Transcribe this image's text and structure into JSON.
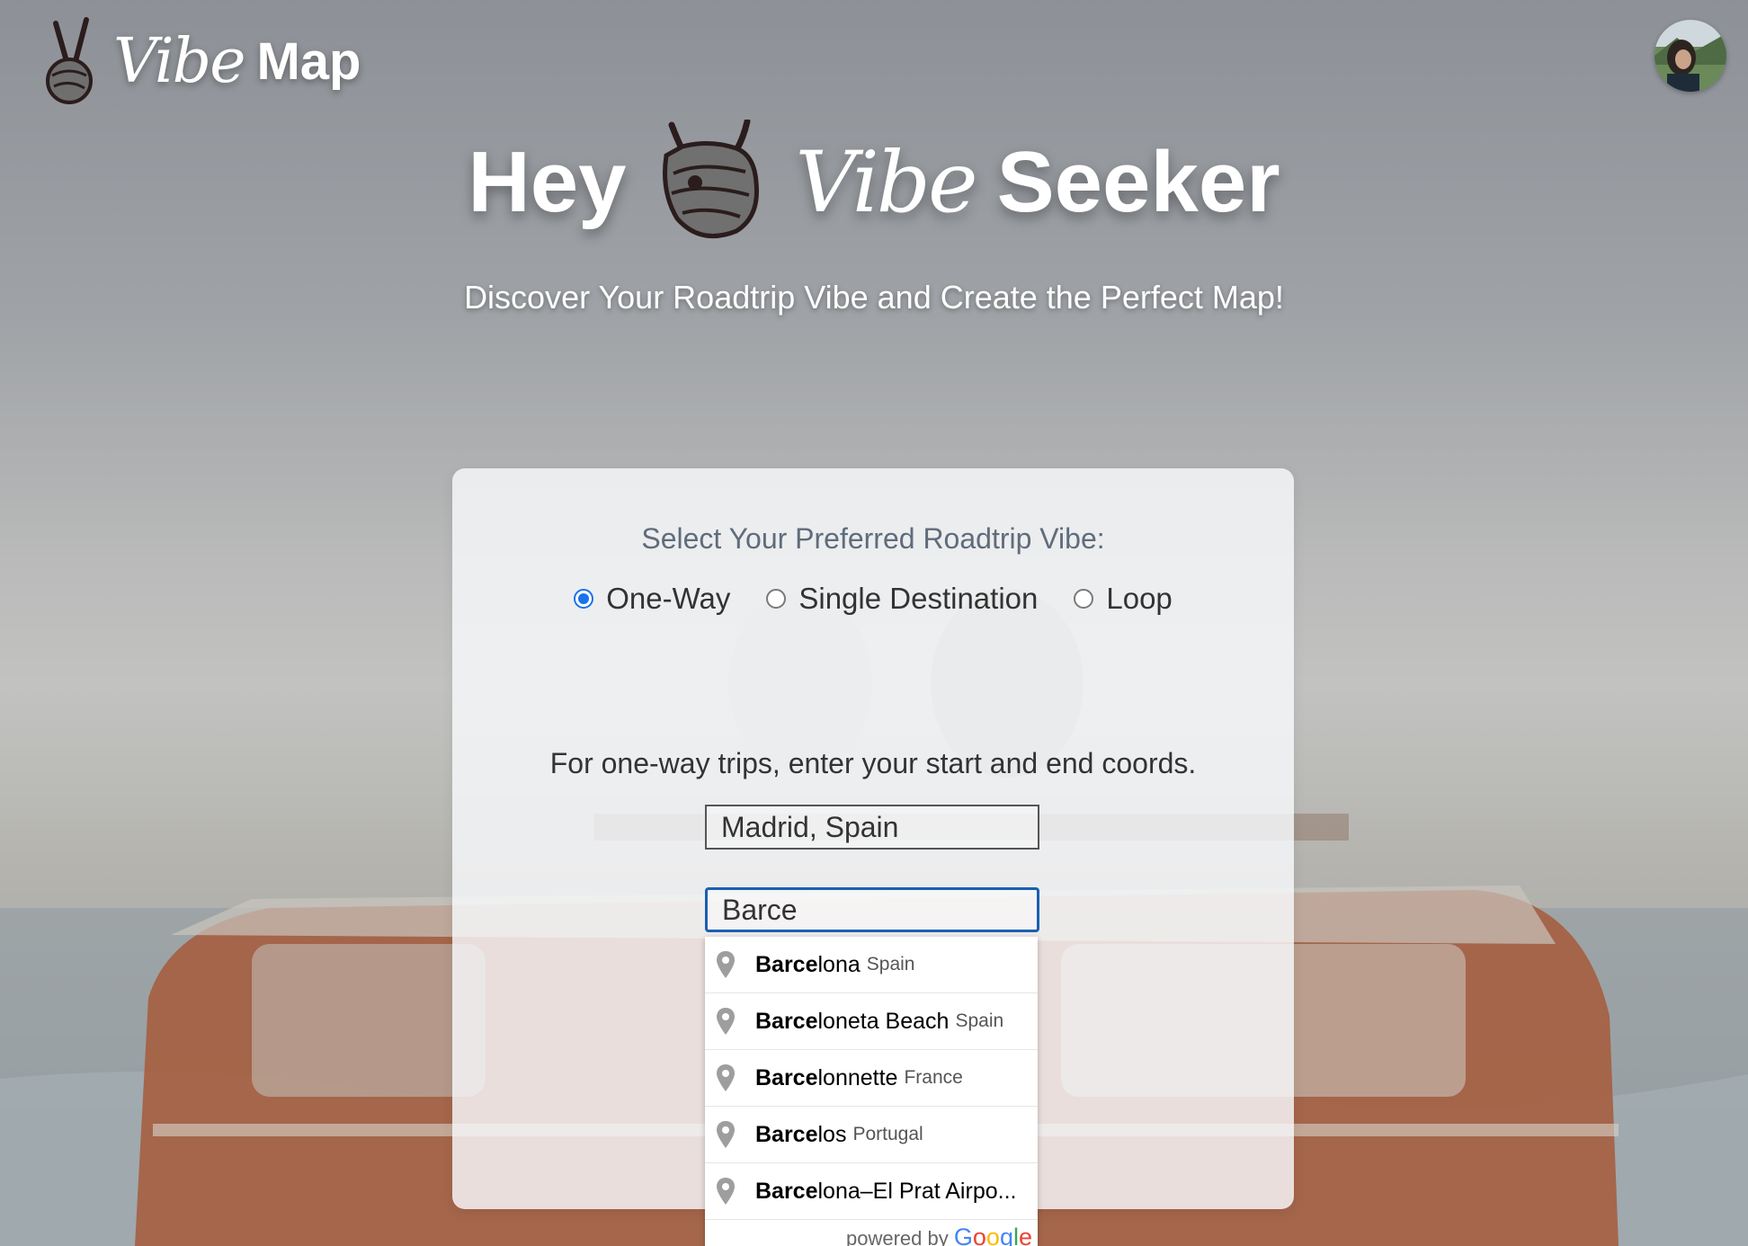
{
  "brand": {
    "vibe": "Vibe",
    "map": "Map"
  },
  "hero": {
    "hey": "Hey",
    "vibe": "Vibe",
    "seeker": "Seeker"
  },
  "subtitle": "Discover Your Roadtrip Vibe and Create the Perfect Map!",
  "card": {
    "prompt": "Select Your Preferred Roadtrip Vibe:",
    "options": [
      {
        "label": "One-Way",
        "checked": true
      },
      {
        "label": "Single Destination",
        "checked": false
      },
      {
        "label": "Loop",
        "checked": false
      }
    ],
    "instructions": "For one-way trips, enter your start and end coords.",
    "start_value": "Madrid, Spain",
    "end_value": "Barce"
  },
  "autocomplete": {
    "items": [
      {
        "match": "Barce",
        "rest": "lona",
        "country": "Spain"
      },
      {
        "match": "Barce",
        "rest": "loneta Beach",
        "country": "Spain"
      },
      {
        "match": "Barce",
        "rest": "lonnette",
        "country": "France"
      },
      {
        "match": "Barce",
        "rest": "los",
        "country": "Portugal"
      },
      {
        "match": "Barce",
        "rest": "lona–El Prat Airpo...",
        "country": ""
      }
    ],
    "powered_by": "powered by",
    "google": "Google"
  },
  "colors": {
    "accent": "#1a73e8",
    "focus_border": "#1a5fb4"
  },
  "icons": {
    "brand_logo": "peace-hand-icon",
    "pin": "map-pin-icon"
  }
}
